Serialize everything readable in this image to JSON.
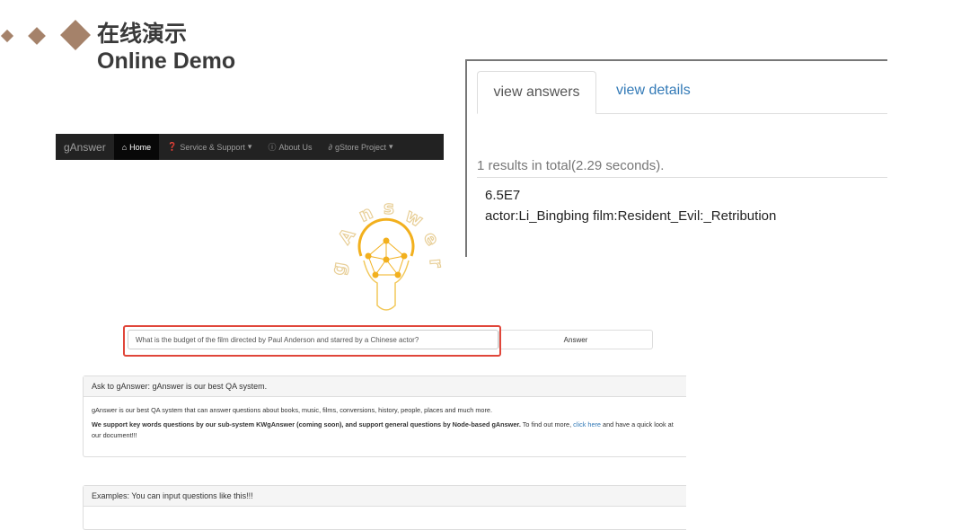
{
  "slide": {
    "title_cn": "在线演示",
    "title_en": "Online Demo",
    "accent": "#a5826a"
  },
  "navbar": {
    "brand": "gAnswer",
    "items": [
      {
        "label": "Home",
        "icon": "home-icon",
        "active": true
      },
      {
        "label": "Service & Support",
        "icon": "question-circle-icon",
        "dropdown": true
      },
      {
        "label": "About Us",
        "icon": "info-circle-icon"
      },
      {
        "label": "gStore Project",
        "icon": "link-icon",
        "dropdown": true
      }
    ]
  },
  "logo": {
    "text": "gAnswer"
  },
  "search": {
    "value": "What is the budget of the film directed by Paul Anderson and starred by a Chinese actor?",
    "button": "Answer"
  },
  "results": {
    "tabs": [
      "view answers",
      "view details"
    ],
    "count": "1 results in total(2.29 seconds).",
    "answers": [
      "6.5E7",
      "actor:Li_Bingbing film:Resident_Evil:_Retribution"
    ]
  },
  "panel1": {
    "heading": "Ask to gAnswer: gAnswer is our best QA system.",
    "p1": "gAnswer is our best QA system that can answer questions about books, music, films, conversions, history, people, places and much more.",
    "p2_bold": "We support key words questions by our sub-system KWgAnswer (coming soon), and support general questions by Node-based gAnswer.",
    "p2_rest": " To find out more, ",
    "link": "click here",
    "p2_end": " and have a quick look at our document!!!"
  },
  "panel2": {
    "heading": "Examples: You can input questions like this!!!"
  }
}
